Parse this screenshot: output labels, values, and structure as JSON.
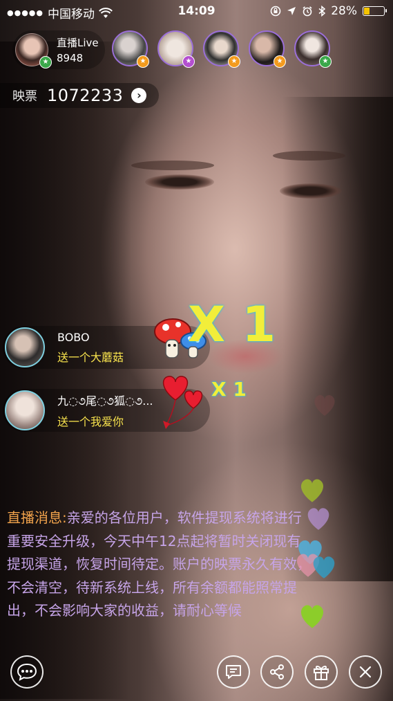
{
  "status_bar": {
    "carrier": "中国移动",
    "time": "14:09",
    "battery_percent": "28%",
    "battery_level": 0.28,
    "battery_color": "#f5c400"
  },
  "host": {
    "label": "直播Live",
    "viewer_count": "8948"
  },
  "viewers": [
    {
      "badge_color": "orange"
    },
    {
      "badge_color": "purple"
    },
    {
      "badge_color": "orange"
    },
    {
      "badge_color": "orange"
    },
    {
      "badge_color": "green"
    }
  ],
  "ticket": {
    "label": "映票",
    "value": "1072233"
  },
  "gifts": [
    {
      "user": "BOBO",
      "message": "送一个大蘑菇",
      "count": "X 1",
      "gift_icon": "mushroom-icon"
    },
    {
      "user": "九◌૭尾◌૭狐◌૭...",
      "message": "送一个我爱你",
      "count": "X 1",
      "gift_icon": "heart-balloons-icon"
    }
  ],
  "notice": {
    "prefix": "直播消息:",
    "text": "亲爱的各位用户，软件提现系统将进行重要安全升级，今天中午12点起将暂时关闭现有提现渠道，恢复时间待定。账户的映票永久有效，不会清空，待新系统上线，所有余额都能照常提出，不会影响大家的收益，请耐心等候"
  },
  "bottom_bar": {
    "chat": "chat-bubble-icon",
    "message": "message-icon",
    "share": "share-icon",
    "gift": "gift-box-icon",
    "close": "close-icon"
  },
  "colors": {
    "notice_prefix": "#f3a44c",
    "notice_text": "#c6a4e8",
    "gift_message": "#f7e24d",
    "gift_count": "#f2ee3a"
  }
}
